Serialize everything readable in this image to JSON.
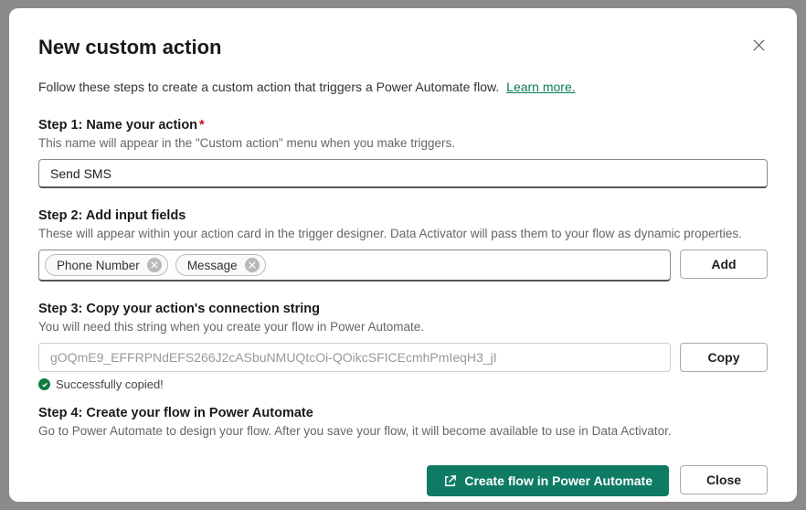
{
  "title": "New custom action",
  "intro_text": "Follow these steps to create a custom action that triggers a Power Automate flow.",
  "learn_more": "Learn more.",
  "step1": {
    "title": "Step 1: Name your action",
    "desc": "This name will appear in the \"Custom action\" menu when you make triggers.",
    "value": "Send SMS"
  },
  "step2": {
    "title": "Step 2: Add input fields",
    "desc": "These will appear within your action card in the trigger designer. Data Activator will pass them to your flow as dynamic properties.",
    "tags": [
      "Phone Number",
      "Message"
    ],
    "add_label": "Add"
  },
  "step3": {
    "title": "Step 3: Copy your action's connection string",
    "desc": "You will need this string when you create your flow in Power Automate.",
    "value": "gOQmE9_EFFRPNdEFS266J2cASbuNMUQtcOi-QOikcSFICEcmhPmIeqH3_jI",
    "copy_label": "Copy",
    "success": "Successfully copied!"
  },
  "step4": {
    "title": "Step 4: Create your flow in Power Automate",
    "desc": "Go to Power Automate to design your flow. After you save your flow, it will become available to use in Data Activator."
  },
  "footer": {
    "primary": "Create flow in Power Automate",
    "close": "Close"
  }
}
